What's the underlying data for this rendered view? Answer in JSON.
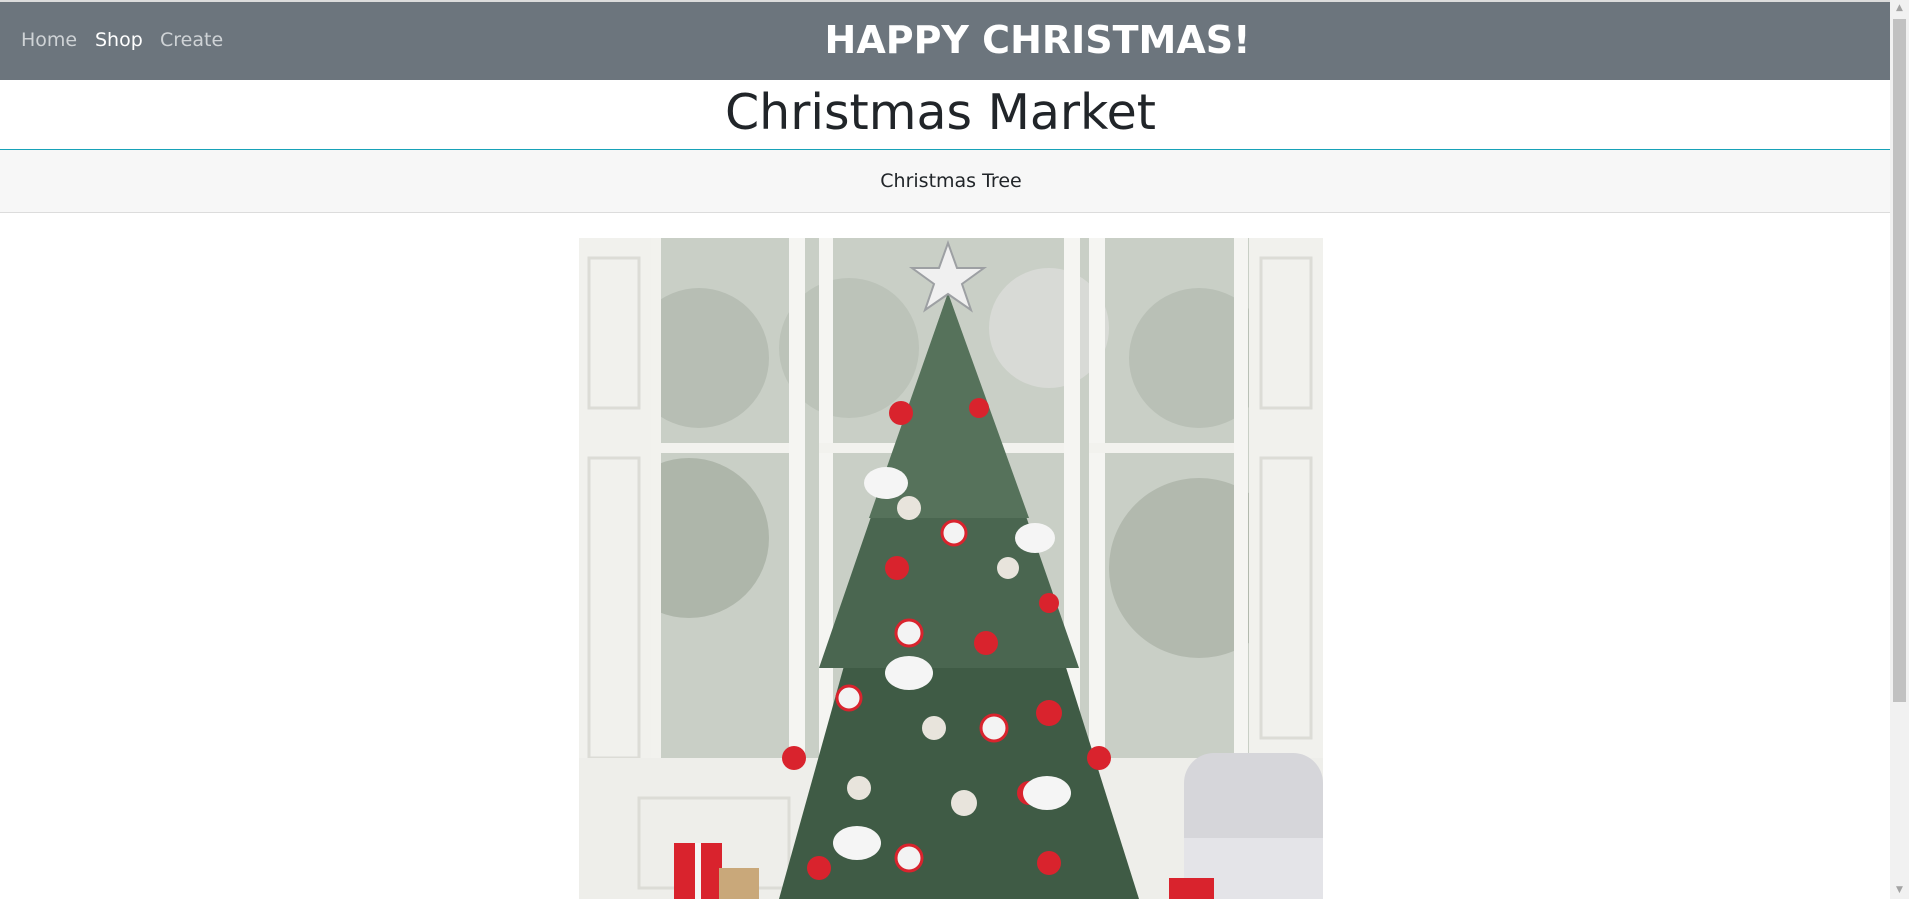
{
  "nav": {
    "links": [
      {
        "label": "Home"
      },
      {
        "label": "Shop"
      },
      {
        "label": "Create"
      }
    ],
    "banner": "HAPPY CHRISTMAS!"
  },
  "page": {
    "title": "Christmas Market"
  },
  "category": {
    "label": "Christmas Tree"
  },
  "product": {
    "image_icon": "christmas-tree-photo"
  },
  "colors": {
    "navbar": "#6c757d",
    "nav_link": "#cfd3d6",
    "nav_active": "#ffffff",
    "divider": "#17a2b8",
    "category_bg": "#f7f7f7"
  }
}
